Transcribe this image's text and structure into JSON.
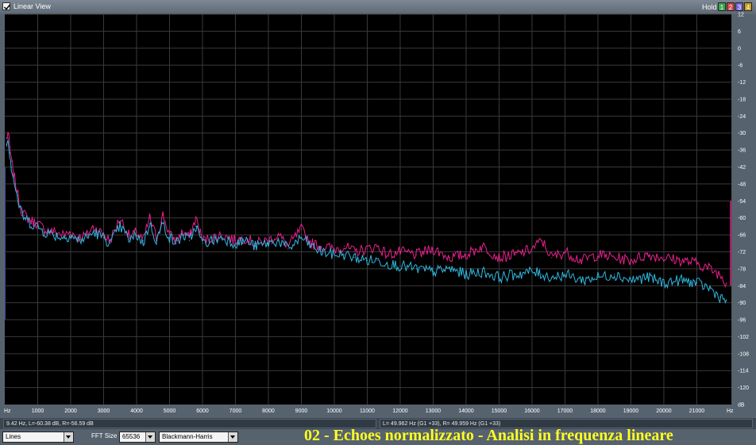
{
  "window": {
    "title": "Linear View",
    "hold_label": "Hold",
    "channel_buttons": [
      {
        "label": "1",
        "color": "#3aa84a"
      },
      {
        "label": "2",
        "color": "#d04848"
      },
      {
        "label": "3",
        "color": "#7866d8"
      },
      {
        "label": "4",
        "color": "#c6a020"
      }
    ]
  },
  "chart_data": {
    "type": "line",
    "x_unit": "Hz",
    "y_unit": "dB",
    "xlim": [
      0,
      22050
    ],
    "ylim": [
      -126,
      12
    ],
    "grid": true,
    "background": "#000000",
    "grid_color": "#3a3a3a",
    "x_ticks": [
      1000,
      2000,
      3000,
      4000,
      5000,
      6000,
      7000,
      8000,
      9000,
      10000,
      11000,
      12000,
      13000,
      14000,
      15000,
      16000,
      17000,
      18000,
      19000,
      20000,
      21000
    ],
    "x_tick_labels": [
      "1000",
      "2000",
      "3000",
      "4000",
      "5000",
      "6000",
      "7000",
      "8000",
      "9000",
      "10000",
      "11000",
      "12000",
      "13000",
      "14000",
      "15000",
      "16000",
      "17000",
      "18000",
      "19000",
      "20000",
      "21000"
    ],
    "x_left_label": "Hz",
    "x_right_label": "Hz",
    "y_ticks": [
      12,
      6,
      0,
      -6,
      -12,
      -18,
      -24,
      -30,
      -36,
      -42,
      -48,
      -54,
      -60,
      -66,
      -72,
      -78,
      -84,
      -90,
      -96,
      -102,
      -108,
      -114,
      -120
    ],
    "y_tick_labels": [
      "12",
      "6",
      "0",
      "-6",
      "-12",
      "-18",
      "-24",
      "-30",
      "-36",
      "-42",
      "-48",
      "-54",
      "-60",
      "-66",
      "-72",
      "-78",
      "-84",
      "-90",
      "-96",
      "-102",
      "-108",
      "-114",
      "-120"
    ],
    "y_bottom_label": "dB",
    "series": [
      {
        "color": "#e8208c",
        "x": [
          50,
          100,
          150,
          200,
          300,
          400,
          500,
          600,
          800,
          1000,
          1200,
          1500,
          1800,
          2000,
          2200,
          2500,
          2700,
          3000,
          3200,
          3500,
          3800,
          4000,
          4200,
          4400,
          4600,
          4800,
          5000,
          5200,
          5400,
          5600,
          5800,
          6000,
          6300,
          6600,
          7000,
          7300,
          7600,
          8000,
          8300,
          8600,
          9000,
          9300,
          9600,
          10000,
          10300,
          10600,
          11000,
          11300,
          11600,
          12000,
          12500,
          13000,
          13500,
          14000,
          14500,
          15000,
          15500,
          16000,
          16300,
          16600,
          17000,
          17500,
          18000,
          18500,
          19000,
          19500,
          20000,
          20500,
          21000,
          21400,
          21700,
          21900
        ],
        "y": [
          -32,
          -30,
          -35,
          -40,
          -46,
          -52,
          -57,
          -59,
          -61,
          -62,
          -64,
          -65,
          -66,
          -65,
          -67,
          -66,
          -63,
          -66,
          -68,
          -60,
          -67,
          -65,
          -68,
          -60,
          -67,
          -59,
          -66,
          -68,
          -65,
          -67,
          -60,
          -68,
          -67,
          -66,
          -68,
          -67,
          -69,
          -68,
          -66,
          -70,
          -64,
          -69,
          -70,
          -71,
          -70,
          -72,
          -71,
          -70,
          -73,
          -72,
          -73,
          -71,
          -74,
          -73,
          -70,
          -74,
          -73,
          -71,
          -68,
          -74,
          -72,
          -75,
          -73,
          -74,
          -75,
          -73,
          -74,
          -75,
          -76,
          -78,
          -80,
          -83
        ]
      },
      {
        "color": "#30b8e0",
        "x": [
          50,
          100,
          150,
          200,
          300,
          400,
          500,
          600,
          800,
          1000,
          1200,
          1500,
          1800,
          2000,
          2200,
          2500,
          2700,
          3000,
          3200,
          3500,
          3800,
          4000,
          4200,
          4400,
          4600,
          4800,
          5000,
          5200,
          5400,
          5600,
          5800,
          6000,
          6300,
          6600,
          7000,
          7300,
          7600,
          8000,
          8300,
          8600,
          9000,
          9300,
          9600,
          10000,
          10300,
          10600,
          11000,
          11300,
          11600,
          12000,
          12500,
          13000,
          13500,
          14000,
          14500,
          15000,
          15500,
          16000,
          16300,
          16600,
          17000,
          17500,
          18000,
          18500,
          19000,
          19500,
          20000,
          20500,
          21000,
          21400,
          21700,
          21900
        ],
        "y": [
          -34,
          -32,
          -37,
          -42,
          -48,
          -54,
          -58,
          -60,
          -62,
          -63,
          -65,
          -66,
          -67,
          -66,
          -68,
          -67,
          -65,
          -67,
          -69,
          -63,
          -68,
          -66,
          -69,
          -62,
          -68,
          -62,
          -67,
          -69,
          -66,
          -68,
          -63,
          -69,
          -68,
          -67,
          -69,
          -68,
          -70,
          -69,
          -68,
          -71,
          -67,
          -70,
          -72,
          -73,
          -73,
          -74,
          -75,
          -75,
          -76,
          -77,
          -78,
          -79,
          -78,
          -80,
          -79,
          -81,
          -80,
          -79,
          -80,
          -81,
          -80,
          -82,
          -81,
          -80,
          -82,
          -81,
          -83,
          -82,
          -83,
          -85,
          -88,
          -89
        ]
      }
    ]
  },
  "status": {
    "left": "9.42 Hz, L=-60.38 dB, R=-56.59 dB",
    "right": "L= 49.962 Hz (G1 +33), R= 49.959 Hz (G1 +33)"
  },
  "toolbar": {
    "display_mode": "Lines",
    "fft_label": "FFT Size",
    "fft_size": "65536",
    "window_function": "Blackmann-Harris"
  },
  "caption": "02 - Echoes normalizzato - Analisi in frequenza lineare"
}
